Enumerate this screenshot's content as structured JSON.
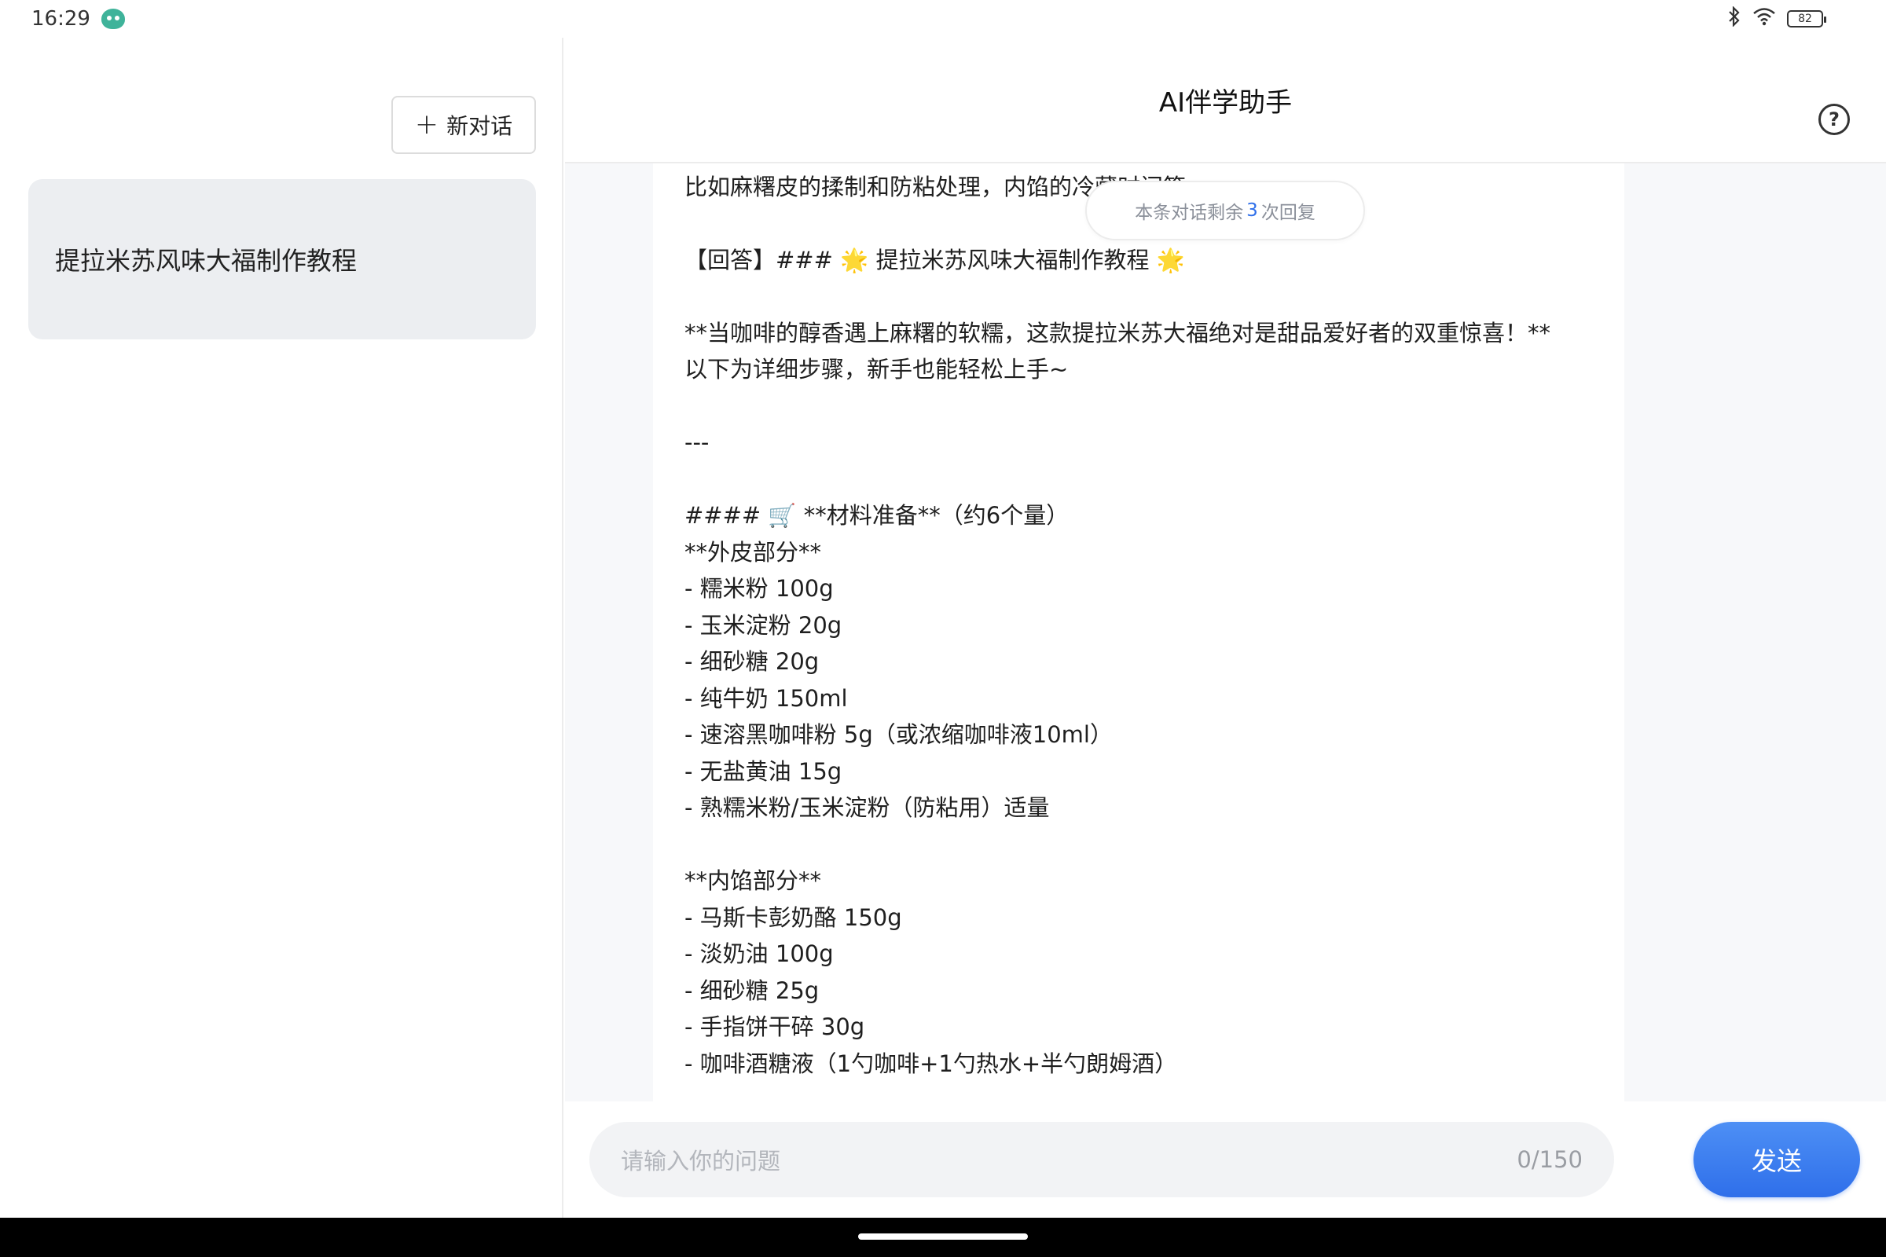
{
  "status_bar": {
    "time": "16:29",
    "battery": "82",
    "icons": [
      "bot-icon",
      "bluetooth-icon",
      "wifi-icon",
      "battery-icon"
    ]
  },
  "sidebar": {
    "new_chat_label": "新对话",
    "conversations": [
      {
        "title": "提拉米苏风味大福制作教程"
      }
    ]
  },
  "header": {
    "title": "AI伴学助手"
  },
  "remaining": {
    "prefix": "本条对话剩余",
    "count": "3",
    "suffix": "次回复"
  },
  "message": {
    "text": "细，特别是外皮和内馅的制作要点，确保用户能成功复制。可能还需要提醒注意事项，\n比如麻糬皮的揉制和防粘处理，内馅的冷藏时间等。\n\n【回答】### 🌟 提拉米苏风味大福制作教程 🌟\n\n**当咖啡的醇香遇上麻糬的软糯，这款提拉米苏大福绝对是甜品爱好者的双重惊喜！**\n以下为详细步骤，新手也能轻松上手~\n\n---\n\n#### 🛒 **材料准备**（约6个量）\n**外皮部分**\n- 糯米粉 100g\n- 玉米淀粉 20g\n- 细砂糖 20g\n- 纯牛奶 150ml\n- 速溶黑咖啡粉 5g（或浓缩咖啡液10ml）\n- 无盐黄油 15g\n- 熟糯米粉/玉米淀粉（防粘用）适量\n\n**内馅部分**\n- 马斯卡彭奶酪 150g\n- 淡奶油 100g\n- 细砂糖 25g\n- 手指饼干碎 30g\n- 咖啡酒糖液（1勺咖啡+1勺热水+半勺朗姆酒）"
  },
  "input": {
    "placeholder": "请输入你的问题",
    "counter": "0/150",
    "send_label": "发送"
  }
}
